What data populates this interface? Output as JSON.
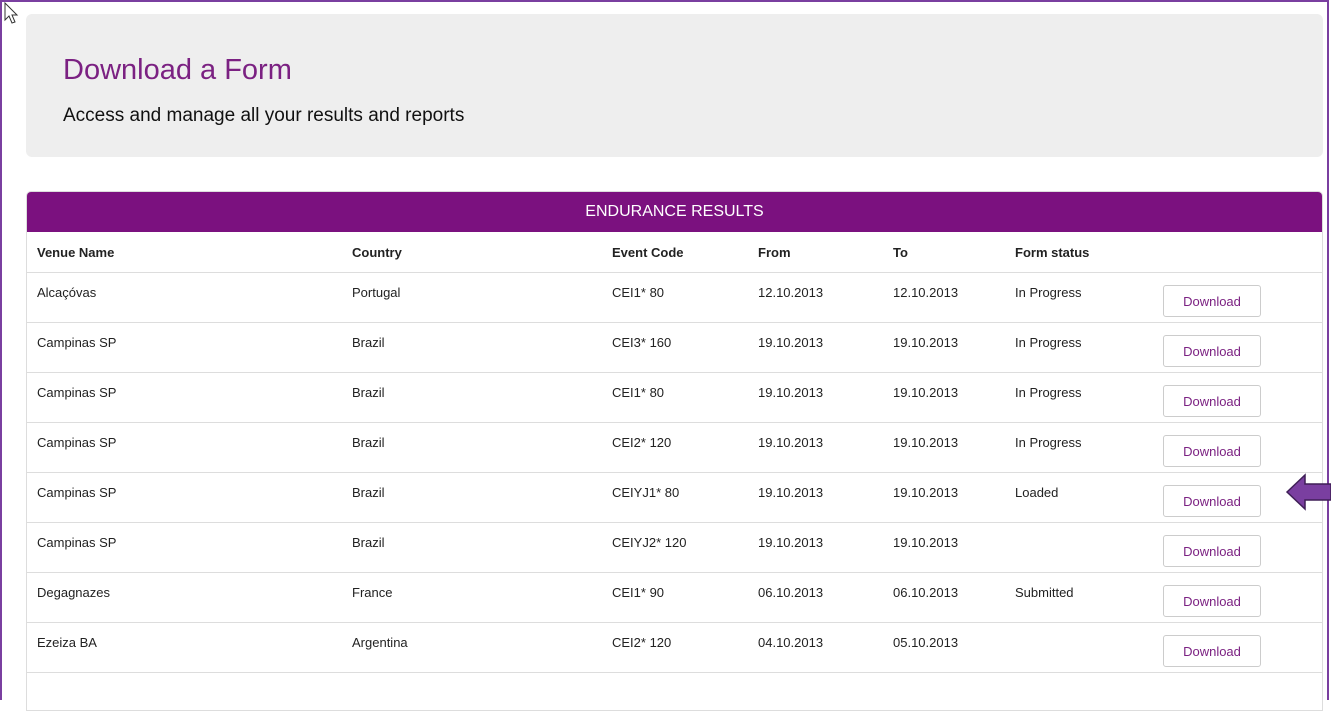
{
  "header": {
    "title": "Download a Form",
    "subtitle": "Access and manage all your results and reports"
  },
  "panel": {
    "title": "ENDURANCE RESULTS"
  },
  "table": {
    "columns": {
      "venue": "Venue Name",
      "country": "Country",
      "event_code": "Event Code",
      "from": "From",
      "to": "To",
      "status": "Form status"
    },
    "rows": [
      {
        "venue": "Alcaçóvas",
        "country": "Portugal",
        "event_code": "CEI1* 80",
        "from": "12.10.2013",
        "to": "12.10.2013",
        "status": "In Progress",
        "action": "Download"
      },
      {
        "venue": "Campinas SP",
        "country": "Brazil",
        "event_code": "CEI3* 160",
        "from": "19.10.2013",
        "to": "19.10.2013",
        "status": "In Progress",
        "action": "Download"
      },
      {
        "venue": "Campinas SP",
        "country": "Brazil",
        "event_code": "CEI1* 80",
        "from": "19.10.2013",
        "to": "19.10.2013",
        "status": "In Progress",
        "action": "Download"
      },
      {
        "venue": "Campinas SP",
        "country": "Brazil",
        "event_code": "CEI2* 120",
        "from": "19.10.2013",
        "to": "19.10.2013",
        "status": "In Progress",
        "action": "Download"
      },
      {
        "venue": "Campinas SP",
        "country": "Brazil",
        "event_code": "CEIYJ1* 80",
        "from": "19.10.2013",
        "to": "19.10.2013",
        "status": "Loaded",
        "action": "Download"
      },
      {
        "venue": "Campinas SP",
        "country": "Brazil",
        "event_code": "CEIYJ2* 120",
        "from": "19.10.2013",
        "to": "19.10.2013",
        "status": "",
        "action": "Download"
      },
      {
        "venue": "Degagnazes",
        "country": "France",
        "event_code": "CEI1* 90",
        "from": "06.10.2013",
        "to": "06.10.2013",
        "status": "Submitted",
        "action": "Download"
      },
      {
        "venue": "Ezeiza BA",
        "country": "Argentina",
        "event_code": "CEI2* 120",
        "from": "04.10.2013",
        "to": "05.10.2013",
        "status": "",
        "action": "Download"
      }
    ]
  },
  "colors": {
    "brand": "#7b117f",
    "title": "#7b2182",
    "arrow": "#7a3fa0",
    "hero_bg": "#eeeeee"
  },
  "icons": {
    "cursor": "mouse-pointer-icon",
    "annotation": "left-arrow-icon"
  }
}
